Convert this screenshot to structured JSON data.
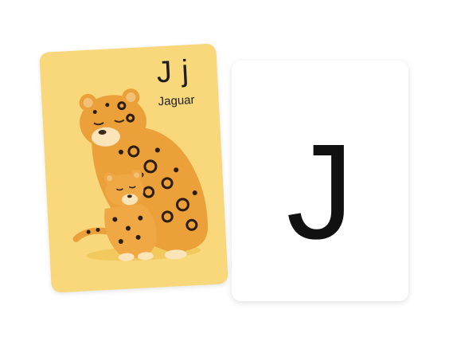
{
  "card_front": {
    "letters": "J j",
    "word": "Jaguar",
    "background_color": "#f8d87a",
    "illustration": "jaguar-mother-and-cub"
  },
  "card_back": {
    "letter": "J",
    "background_color": "#ffffff"
  }
}
